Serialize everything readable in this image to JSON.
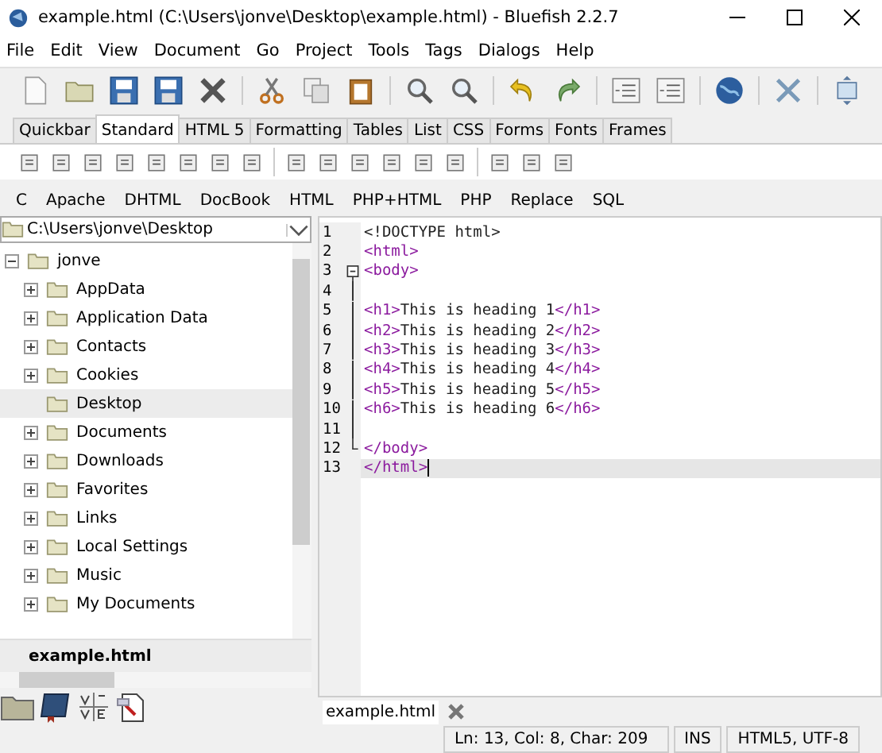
{
  "window": {
    "title": "example.html (C:\\Users\\jonve\\Desktop\\example.html) - Bluefish 2.2.7"
  },
  "menu": [
    "File",
    "Edit",
    "View",
    "Document",
    "Go",
    "Project",
    "Tools",
    "Tags",
    "Dialogs",
    "Help"
  ],
  "tabs": [
    {
      "label": "Quickbar",
      "selected": false
    },
    {
      "label": "Standard",
      "selected": true
    },
    {
      "label": "HTML 5",
      "selected": false
    },
    {
      "label": "Formatting",
      "selected": false
    },
    {
      "label": "Tables",
      "selected": false
    },
    {
      "label": "List",
      "selected": false
    },
    {
      "label": "CSS",
      "selected": false
    },
    {
      "label": "Forms",
      "selected": false
    },
    {
      "label": "Fonts",
      "selected": false
    },
    {
      "label": "Frames",
      "selected": false
    }
  ],
  "snippets": [
    "C",
    "Apache",
    "DHTML",
    "DocBook",
    "HTML",
    "PHP+HTML",
    "PHP",
    "Replace",
    "SQL"
  ],
  "sidebar": {
    "path": "C:\\Users\\jonve\\Desktop",
    "tree": {
      "label": "jonve",
      "expanded": true,
      "children": [
        {
          "label": "AppData",
          "expandable": true,
          "selected": false
        },
        {
          "label": "Application Data",
          "expandable": true,
          "selected": false
        },
        {
          "label": "Contacts",
          "expandable": true,
          "selected": false
        },
        {
          "label": "Cookies",
          "expandable": true,
          "selected": false
        },
        {
          "label": "Desktop",
          "expandable": false,
          "selected": true
        },
        {
          "label": "Documents",
          "expandable": true,
          "selected": false
        },
        {
          "label": "Downloads",
          "expandable": true,
          "selected": false
        },
        {
          "label": "Favorites",
          "expandable": true,
          "selected": false
        },
        {
          "label": "Links",
          "expandable": true,
          "selected": false
        },
        {
          "label": "Local Settings",
          "expandable": true,
          "selected": false
        },
        {
          "label": "Music",
          "expandable": true,
          "selected": false
        },
        {
          "label": "My Documents",
          "expandable": true,
          "selected": false
        }
      ]
    },
    "files": [
      {
        "name": "example.html",
        "selected": true
      }
    ]
  },
  "editor": {
    "lines": [
      {
        "number": "1",
        "kind": "plain",
        "current": false,
        "segments": [
          {
            "kind": "text",
            "text": "<!DOCTYPE html>"
          }
        ]
      },
      {
        "number": "2",
        "kind": "plain",
        "current": false,
        "segments": [
          {
            "kind": "tag",
            "text": "<html>"
          }
        ]
      },
      {
        "number": "3",
        "kind": "foldstart",
        "current": false,
        "segments": [
          {
            "kind": "tag",
            "text": "<body>"
          }
        ]
      },
      {
        "number": "4",
        "kind": "foldbody",
        "current": false
      },
      {
        "number": "5",
        "kind": "foldbody",
        "current": false,
        "segments": [
          {
            "kind": "tag",
            "text": "<h1>"
          },
          {
            "kind": "text",
            "text": "This is heading 1"
          },
          {
            "kind": "tag",
            "text": "</h1>"
          }
        ]
      },
      {
        "number": "6",
        "kind": "foldbody",
        "current": false,
        "segments": [
          {
            "kind": "tag",
            "text": "<h2>"
          },
          {
            "kind": "text",
            "text": "This is heading 2"
          },
          {
            "kind": "tag",
            "text": "</h2>"
          }
        ]
      },
      {
        "number": "7",
        "kind": "foldbody",
        "current": false,
        "segments": [
          {
            "kind": "tag",
            "text": "<h3>"
          },
          {
            "kind": "text",
            "text": "This is heading 3"
          },
          {
            "kind": "tag",
            "text": "</h3>"
          }
        ]
      },
      {
        "number": "8",
        "kind": "foldbody",
        "current": false,
        "segments": [
          {
            "kind": "tag",
            "text": "<h4>"
          },
          {
            "kind": "text",
            "text": "This is heading 4"
          },
          {
            "kind": "tag",
            "text": "</h4>"
          }
        ]
      },
      {
        "number": "9",
        "kind": "foldbody",
        "current": false,
        "segments": [
          {
            "kind": "tag",
            "text": "<h5>"
          },
          {
            "kind": "text",
            "text": "This is heading 5"
          },
          {
            "kind": "tag",
            "text": "</h5>"
          }
        ]
      },
      {
        "number": "10",
        "kind": "foldbody",
        "current": false,
        "segments": [
          {
            "kind": "tag",
            "text": "<h6>"
          },
          {
            "kind": "text",
            "text": "This is heading 6"
          },
          {
            "kind": "tag",
            "text": "</h6>"
          }
        ]
      },
      {
        "number": "11",
        "kind": "foldbody",
        "current": false
      },
      {
        "number": "12",
        "kind": "foldend",
        "current": false,
        "segments": [
          {
            "kind": "tag",
            "text": "</body>"
          }
        ]
      },
      {
        "number": "13",
        "kind": "plain",
        "current": true,
        "segments": [
          {
            "kind": "tag",
            "text": "</html>"
          }
        ]
      }
    ],
    "tab": "example.html"
  },
  "status_bar": {
    "position": "Ln: 13, Col: 8, Char: 209",
    "mode": "INS",
    "format": "HTML5, UTF-8"
  }
}
